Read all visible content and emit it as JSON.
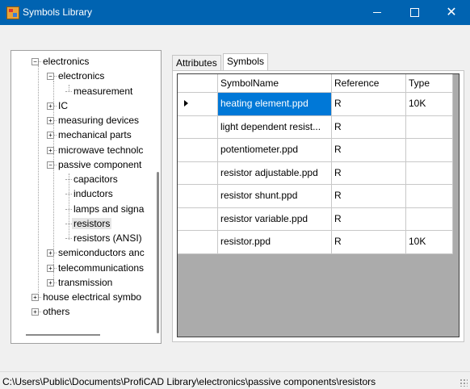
{
  "window": {
    "title": "Symbols Library"
  },
  "tree": {
    "items": [
      {
        "label": "electronics",
        "expander": "minus"
      },
      {
        "label": "electronics",
        "expander": "minus"
      },
      {
        "label": "measurement",
        "expander": ""
      },
      {
        "label": "IC",
        "expander": "plus"
      },
      {
        "label": "measuring devices",
        "expander": "plus"
      },
      {
        "label": "mechanical parts",
        "expander": "plus"
      },
      {
        "label": "microwave technolc",
        "expander": "plus"
      },
      {
        "label": "passive component",
        "expander": "minus"
      },
      {
        "label": "capacitors",
        "expander": ""
      },
      {
        "label": "inductors",
        "expander": ""
      },
      {
        "label": "lamps and signa",
        "expander": ""
      },
      {
        "label": "resistors",
        "expander": ""
      },
      {
        "label": "resistors (ANSI)",
        "expander": ""
      },
      {
        "label": "semiconductors anc",
        "expander": "plus"
      },
      {
        "label": "telecommunications",
        "expander": "plus"
      },
      {
        "label": "transmission",
        "expander": "plus"
      },
      {
        "label": "house electrical symbo",
        "expander": "plus"
      },
      {
        "label": "others",
        "expander": "plus"
      }
    ],
    "selected_label": "resistors"
  },
  "tabs": [
    {
      "label": "Attributes"
    },
    {
      "label": "Symbols"
    }
  ],
  "active_tab": "Symbols",
  "grid": {
    "columns": [
      "SymbolName",
      "Reference",
      "Type"
    ],
    "rows": [
      {
        "name": "heating element.ppd",
        "reference": "R",
        "type": "10K"
      },
      {
        "name": "light dependent resist...",
        "reference": "R",
        "type": ""
      },
      {
        "name": "potentiometer.ppd",
        "reference": "R",
        "type": ""
      },
      {
        "name": "resistor adjustable.ppd",
        "reference": "R",
        "type": ""
      },
      {
        "name": "resistor shunt.ppd",
        "reference": "R",
        "type": ""
      },
      {
        "name": "resistor variable.ppd",
        "reference": "R",
        "type": ""
      },
      {
        "name": "resistor.ppd",
        "reference": "R",
        "type": "10K"
      }
    ],
    "selected_row": 0
  },
  "status": {
    "path": "C:\\Users\\Public\\Documents\\ProfiCAD Library\\electronics\\passive components\\resistors"
  },
  "colors": {
    "titlebar": "#0063b1",
    "selection": "#0078d7",
    "grid_empty": "#ababab"
  }
}
